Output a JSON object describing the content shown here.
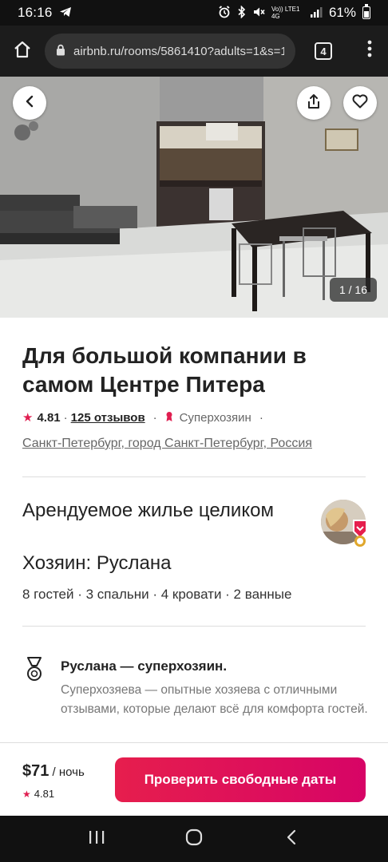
{
  "status": {
    "time": "16:16",
    "network": "Vo)) LTE1 4G",
    "battery": "61%"
  },
  "browser": {
    "url": "airbnb.ru/rooms/5861410?adults=1&s=1",
    "tab_count": "4"
  },
  "photo": {
    "counter": "1 / 16"
  },
  "listing": {
    "title": "Для большой компании в самом Центре Питера",
    "rating": "4.81",
    "reviews": "125 отзывов",
    "superhost": "Суперхозяин",
    "location": "Санкт-Петербург, город Санкт-Петербург, Россия",
    "type": "Арендуемое жилье целиком",
    "host": "Хозяин: Руслана",
    "capacity": "8 гостей · 3 спальни · 4 кровати · 2 ванные"
  },
  "superhost_info": {
    "title": "Руслана — суперхозяин.",
    "description": "Суперхозяева — опытные хозяева с отличными отзывами, которые делают всё для комфорта гостей."
  },
  "footer": {
    "price": "$71",
    "per_night": "/ ночь",
    "rating": "4.81",
    "cta": "Проверить свободные даты"
  },
  "colors": {
    "brand": "#e61e4d",
    "superhost": "#e01e50"
  },
  "icons": [
    "telegram-icon",
    "alarm-icon",
    "bluetooth-icon",
    "mute-icon",
    "signal-icon",
    "battery-icon",
    "home-icon",
    "lock-icon",
    "tabs-icon",
    "more-vertical-icon",
    "back-arrow-icon",
    "share-icon",
    "heart-icon",
    "star-icon",
    "superhost-ribbon-icon",
    "recents-icon",
    "home-circle-icon",
    "back-chevron-icon"
  ]
}
